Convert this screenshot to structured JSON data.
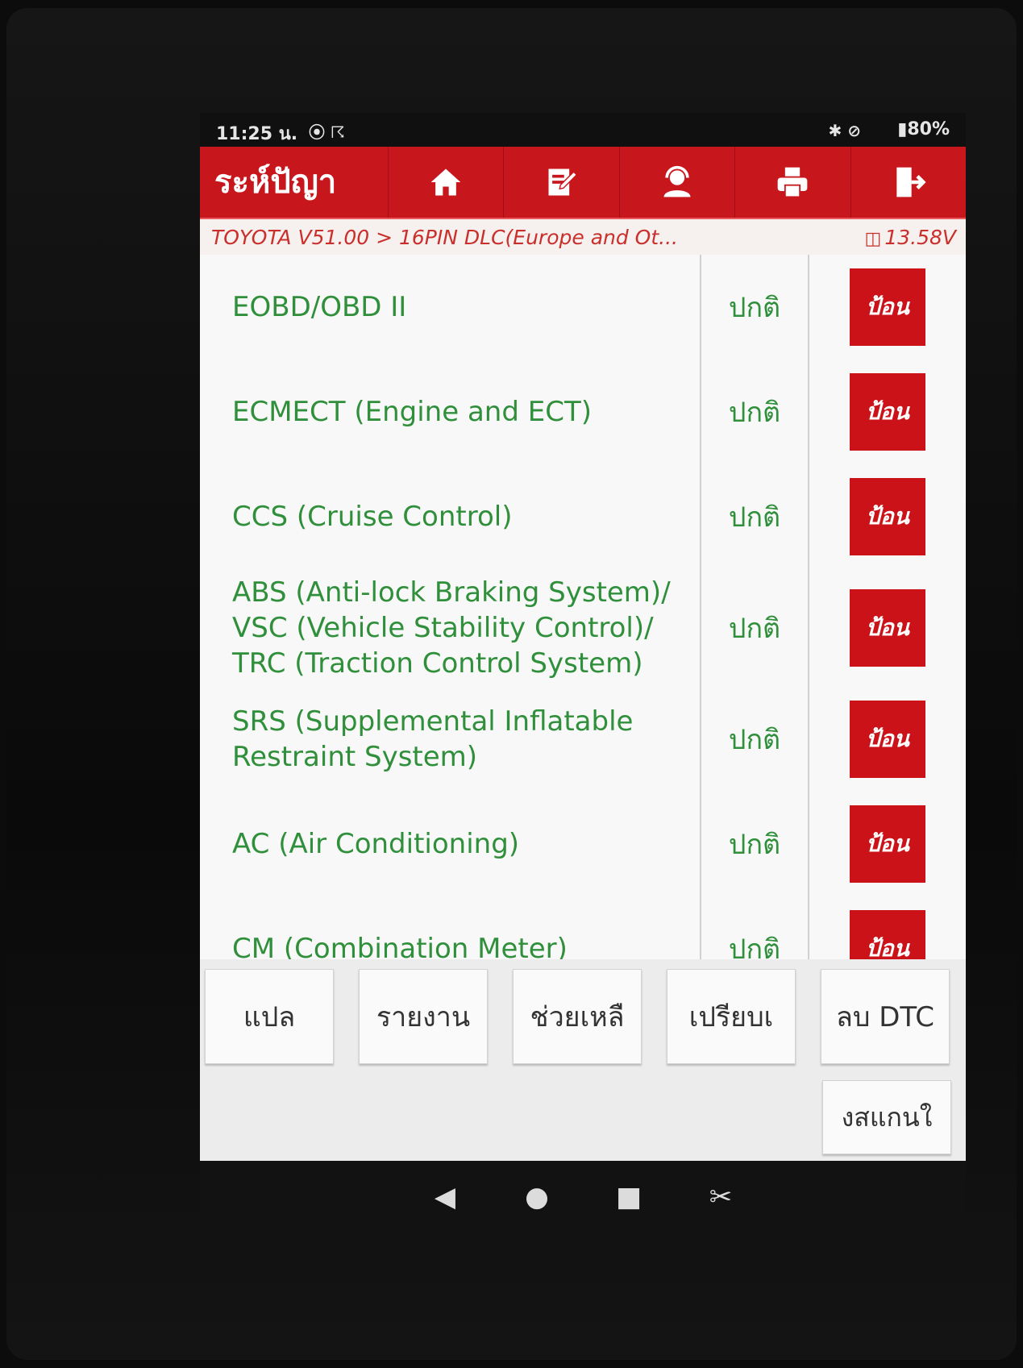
{
  "status_bar": {
    "time": "11:25 น.",
    "left_icons": "⦿ ☈",
    "right_icons": "✱ ⊘",
    "battery": "▮80%"
  },
  "header": {
    "title": "ระห์ปัญา",
    "buttons": [
      {
        "name": "home-button",
        "icon": "home-icon"
      },
      {
        "name": "edit-button",
        "icon": "edit-icon"
      },
      {
        "name": "support-button",
        "icon": "support-icon"
      },
      {
        "name": "print-button",
        "icon": "printer-icon"
      },
      {
        "name": "exit-button",
        "icon": "exit-icon"
      }
    ]
  },
  "breadcrumb": {
    "path": "TOYOTA V51.00 > 16PIN DLC(Europe and Ot...",
    "voltage": "13.58V"
  },
  "systems": [
    {
      "name": "EOBD/OBD II",
      "status": "ปกติ",
      "action": "ป้อน"
    },
    {
      "name": "ECMECT (Engine and ECT)",
      "status": "ปกติ",
      "action": "ป้อน"
    },
    {
      "name": "CCS (Cruise Control)",
      "status": "ปกติ",
      "action": "ป้อน"
    },
    {
      "name": "ABS (Anti-lock Braking System)/\nVSC (Vehicle Stability Control)/\nTRC (Traction Control System)",
      "status": "ปกติ",
      "action": "ป้อน"
    },
    {
      "name": "SRS (Supplemental Inflatable\nRestraint System)",
      "status": "ปกติ",
      "action": "ป้อน"
    },
    {
      "name": "AC (Air Conditioning)",
      "status": "ปกติ",
      "action": "ป้อน"
    },
    {
      "name": "CM (Combination Meter)",
      "status": "ปกติ",
      "action": "ป้อน"
    }
  ],
  "toolbar": {
    "translate": "แปล",
    "report": "รายงาน",
    "help": "ช่วยเหลื",
    "compare": "เปรียบเ",
    "clear_dtc": "ลบ DTC",
    "rescan": "งสแกนใ"
  },
  "navbar": {
    "back": "◀",
    "home": "●",
    "recents": "■",
    "screenshot": "✂"
  },
  "colors": {
    "brand_red": "#c8161d",
    "status_green": "#2f8f3a"
  }
}
